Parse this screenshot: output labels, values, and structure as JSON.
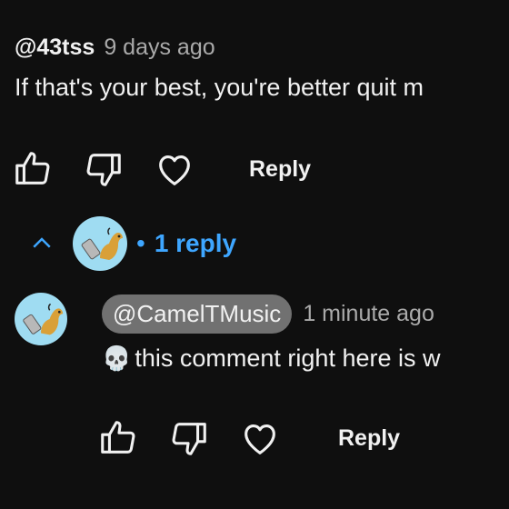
{
  "top_comment": {
    "handle": "@43tss",
    "time": "9 days ago",
    "text": "If that's your best, you're better quit m",
    "reply_label": "Reply",
    "icons": [
      "thumbs-up-icon",
      "thumbs-down-icon",
      "heart-icon"
    ]
  },
  "replies": {
    "count_label": "1 reply",
    "separator": "•",
    "icon": "chevron-up-icon"
  },
  "reply": {
    "mention": "@CamelTMusic",
    "time": "1 minute ago",
    "emoji": "💀",
    "text": "this comment right here is w",
    "reply_label": "Reply",
    "icons": [
      "thumbs-up-icon",
      "thumbs-down-icon",
      "heart-icon"
    ]
  },
  "colors": {
    "background": "#0f0f0f",
    "text": "#f1f1f1",
    "muted": "#aaaaaa",
    "link_blue": "#3ea6ff",
    "mention_chip": "#717171",
    "avatar_bg": "#9fdcf2"
  }
}
